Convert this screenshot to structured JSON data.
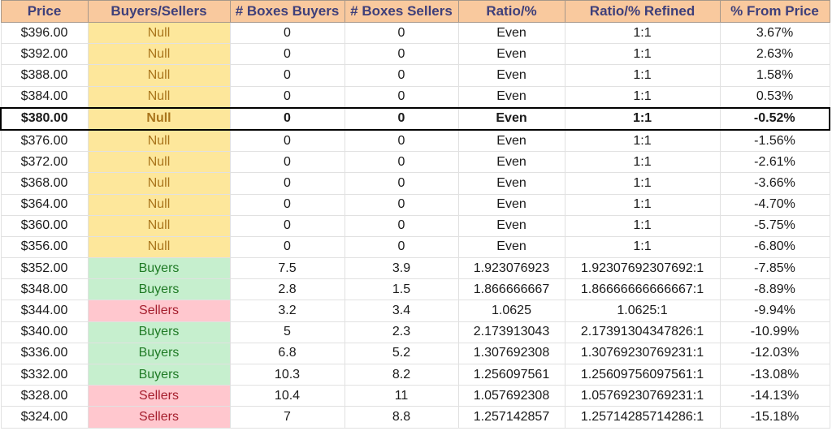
{
  "table": {
    "headers": [
      "Price",
      "Buyers/Sellers",
      "# Boxes Buyers",
      "# Boxes Sellers",
      "Ratio/%",
      "Ratio/% Refined",
      "% From Price"
    ],
    "current_price_row_index": 4,
    "colors": {
      "header_bg": "#f9c99e",
      "header_text": "#3e3f7a",
      "null_bg": "#fde79b",
      "null_text": "#a9751c",
      "buyers_bg": "#c6efce",
      "buyers_text": "#1f7a25",
      "sellers_bg": "#ffc7ce",
      "sellers_text": "#a51e2d"
    },
    "rows": [
      {
        "price": "$396.00",
        "side": "Null",
        "boxes_buyers": "0",
        "boxes_sellers": "0",
        "ratio": "Even",
        "ratio_refined": "1:1",
        "from_price": "3.67%"
      },
      {
        "price": "$392.00",
        "side": "Null",
        "boxes_buyers": "0",
        "boxes_sellers": "0",
        "ratio": "Even",
        "ratio_refined": "1:1",
        "from_price": "2.63%"
      },
      {
        "price": "$388.00",
        "side": "Null",
        "boxes_buyers": "0",
        "boxes_sellers": "0",
        "ratio": "Even",
        "ratio_refined": "1:1",
        "from_price": "1.58%"
      },
      {
        "price": "$384.00",
        "side": "Null",
        "boxes_buyers": "0",
        "boxes_sellers": "0",
        "ratio": "Even",
        "ratio_refined": "1:1",
        "from_price": "0.53%"
      },
      {
        "price": "$380.00",
        "side": "Null",
        "boxes_buyers": "0",
        "boxes_sellers": "0",
        "ratio": "Even",
        "ratio_refined": "1:1",
        "from_price": "-0.52%"
      },
      {
        "price": "$376.00",
        "side": "Null",
        "boxes_buyers": "0",
        "boxes_sellers": "0",
        "ratio": "Even",
        "ratio_refined": "1:1",
        "from_price": "-1.56%"
      },
      {
        "price": "$372.00",
        "side": "Null",
        "boxes_buyers": "0",
        "boxes_sellers": "0",
        "ratio": "Even",
        "ratio_refined": "1:1",
        "from_price": "-2.61%"
      },
      {
        "price": "$368.00",
        "side": "Null",
        "boxes_buyers": "0",
        "boxes_sellers": "0",
        "ratio": "Even",
        "ratio_refined": "1:1",
        "from_price": "-3.66%"
      },
      {
        "price": "$364.00",
        "side": "Null",
        "boxes_buyers": "0",
        "boxes_sellers": "0",
        "ratio": "Even",
        "ratio_refined": "1:1",
        "from_price": "-4.70%"
      },
      {
        "price": "$360.00",
        "side": "Null",
        "boxes_buyers": "0",
        "boxes_sellers": "0",
        "ratio": "Even",
        "ratio_refined": "1:1",
        "from_price": "-5.75%"
      },
      {
        "price": "$356.00",
        "side": "Null",
        "boxes_buyers": "0",
        "boxes_sellers": "0",
        "ratio": "Even",
        "ratio_refined": "1:1",
        "from_price": "-6.80%"
      },
      {
        "price": "$352.00",
        "side": "Buyers",
        "boxes_buyers": "7.5",
        "boxes_sellers": "3.9",
        "ratio": "1.923076923",
        "ratio_refined": "1.92307692307692:1",
        "from_price": "-7.85%"
      },
      {
        "price": "$348.00",
        "side": "Buyers",
        "boxes_buyers": "2.8",
        "boxes_sellers": "1.5",
        "ratio": "1.866666667",
        "ratio_refined": "1.86666666666667:1",
        "from_price": "-8.89%"
      },
      {
        "price": "$344.00",
        "side": "Sellers",
        "boxes_buyers": "3.2",
        "boxes_sellers": "3.4",
        "ratio": "1.0625",
        "ratio_refined": "1.0625:1",
        "from_price": "-9.94%"
      },
      {
        "price": "$340.00",
        "side": "Buyers",
        "boxes_buyers": "5",
        "boxes_sellers": "2.3",
        "ratio": "2.173913043",
        "ratio_refined": "2.17391304347826:1",
        "from_price": "-10.99%"
      },
      {
        "price": "$336.00",
        "side": "Buyers",
        "boxes_buyers": "6.8",
        "boxes_sellers": "5.2",
        "ratio": "1.307692308",
        "ratio_refined": "1.30769230769231:1",
        "from_price": "-12.03%"
      },
      {
        "price": "$332.00",
        "side": "Buyers",
        "boxes_buyers": "10.3",
        "boxes_sellers": "8.2",
        "ratio": "1.256097561",
        "ratio_refined": "1.25609756097561:1",
        "from_price": "-13.08%"
      },
      {
        "price": "$328.00",
        "side": "Sellers",
        "boxes_buyers": "10.4",
        "boxes_sellers": "11",
        "ratio": "1.057692308",
        "ratio_refined": "1.05769230769231:1",
        "from_price": "-14.13%"
      },
      {
        "price": "$324.00",
        "side": "Sellers",
        "boxes_buyers": "7",
        "boxes_sellers": "8.8",
        "ratio": "1.257142857",
        "ratio_refined": "1.25714285714286:1",
        "from_price": "-15.18%"
      }
    ]
  }
}
